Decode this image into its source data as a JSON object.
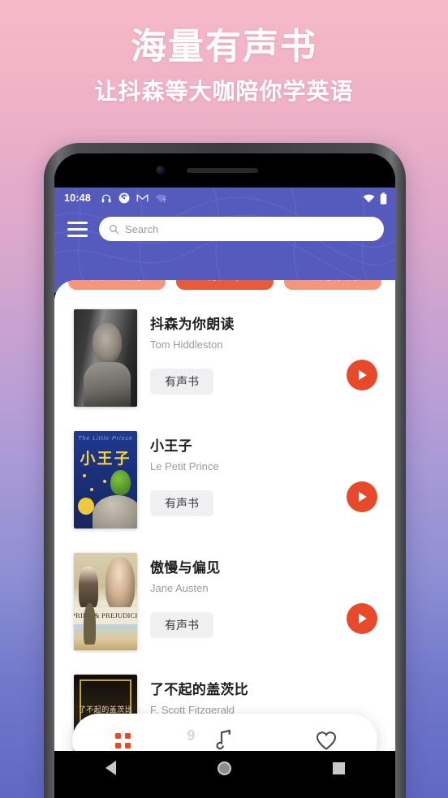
{
  "promo": {
    "title": "海量有声书",
    "subtitle": "让抖森等大咖陪你学英语",
    "gradient_top": "#f6b9c7",
    "gradient_bottom": "#5f68c4"
  },
  "status_bar": {
    "time": "10:48",
    "left_icons": [
      "headphone-icon",
      "chrome-circle-icon",
      "gmail-icon",
      "wifi-question-icon"
    ],
    "right_icons": [
      "wifi-off-icon",
      "battery-full-icon"
    ]
  },
  "header": {
    "background_color": "#555bbd",
    "menu_icon": "hamburger-menu-icon",
    "search": {
      "placeholder": "Search",
      "value": "",
      "icon": "search-icon"
    }
  },
  "tabs": [
    {
      "label": "真题听力",
      "active": false
    },
    {
      "label": "有声书",
      "active": true
    },
    {
      "label": "听力素材",
      "active": false
    }
  ],
  "tab_colors": {
    "inactive": "#f79479",
    "active": "#ea5a36"
  },
  "books": [
    {
      "title": "抖森为你朗读",
      "author": "Tom Hiddleston",
      "tag": "有声书",
      "cover": "tom-hiddleston-portrait",
      "play_label": "play-icon"
    },
    {
      "title": "小王子",
      "author": "Le Petit Prince",
      "tag": "有声书",
      "cover": "little-prince-book-cover",
      "cover_text": {
        "main": "小王子",
        "top": "The Little Prince"
      },
      "play_label": "play-icon"
    },
    {
      "title": "傲慢与偏见",
      "author": "Jane Austen",
      "tag": "有声书",
      "cover": "pride-and-prejudice-poster",
      "cover_text": {
        "band": "PRIDE & PREJUDICE"
      },
      "play_label": "play-icon"
    },
    {
      "title": "了不起的盖茨比",
      "author": "F. Scott Fitzgerald",
      "tag": "有声书",
      "cover": "great-gatsby-poster",
      "cover_text": {
        "band": "了不起的盖茨比"
      },
      "play_label": "play-icon"
    }
  ],
  "float_bar": {
    "grid_icon": "grid-dots-icon",
    "music_icon": "music-note-icon",
    "music_badge": "9",
    "favorite_icon": "heart-outline-icon",
    "accent_color": "#e8492a"
  },
  "android_nav": {
    "back": "back-triangle-icon",
    "home": "home-circle-icon",
    "recents": "recents-square-icon"
  },
  "play_button_color": "#e8492a"
}
